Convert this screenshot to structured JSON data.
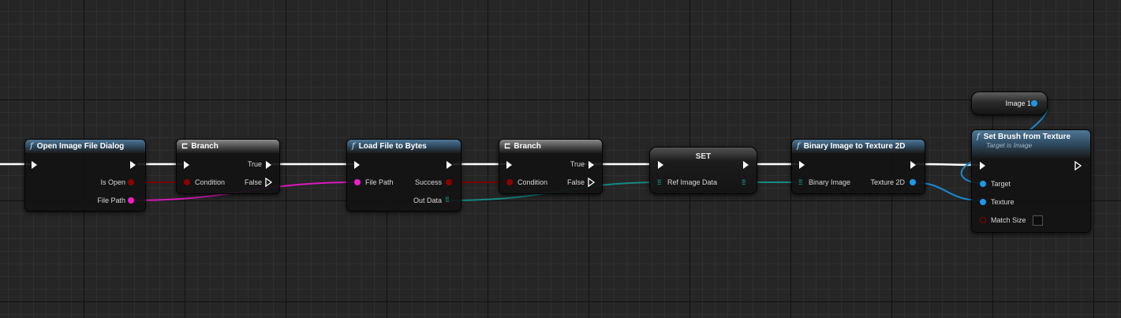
{
  "colors": {
    "exec_wire": "#ffffff",
    "string_pin": "#f01ec8",
    "bool_pin": "#8c0000",
    "object_pin": "#1a9ae8",
    "bytes_pin": "#1faea0"
  },
  "nodes": {
    "open_dialog": {
      "icon": "function-icon",
      "title": "Open Image File Dialog",
      "out_is_open": "Is Open",
      "out_file_path": "File Path"
    },
    "branch1": {
      "icon": "branch-icon",
      "title": "Branch",
      "in_condition": "Condition",
      "out_true": "True",
      "out_false": "False"
    },
    "load_file": {
      "icon": "function-icon",
      "title": "Load File to Bytes",
      "in_file_path": "File Path",
      "out_success": "Success",
      "out_data": "Out Data"
    },
    "branch2": {
      "icon": "branch-icon",
      "title": "Branch",
      "in_condition": "Condition",
      "out_true": "True",
      "out_false": "False"
    },
    "set": {
      "title": "SET",
      "in_ref": "Ref Image Data"
    },
    "binary_to_tex": {
      "icon": "function-icon",
      "title": "Binary Image to Texture 2D",
      "in_binary": "Binary Image",
      "out_texture": "Texture 2D"
    },
    "get_image": {
      "label": "Image 1"
    },
    "set_brush": {
      "icon": "function-icon",
      "title": "Set Brush from Texture",
      "subtitle": "Target is Image",
      "in_target": "Target",
      "in_texture": "Texture",
      "in_match": "Match Size"
    }
  }
}
